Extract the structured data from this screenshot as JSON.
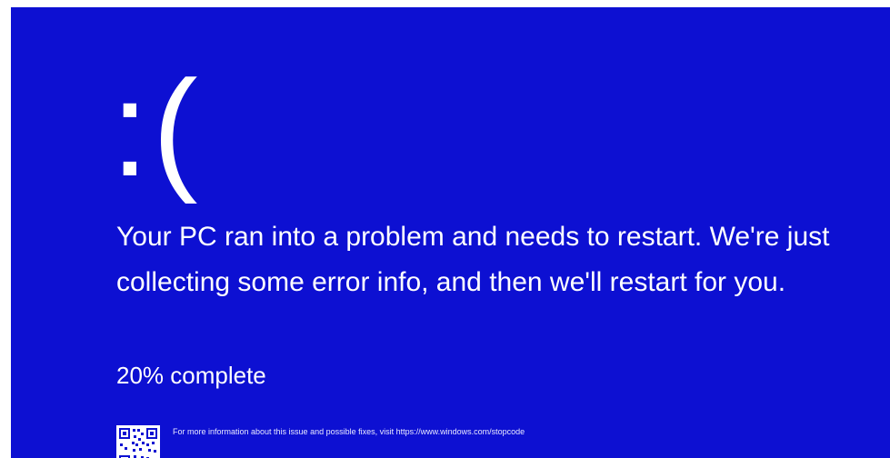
{
  "screen": {
    "background_color": "#0d10d2",
    "text_color": "#ffffff",
    "sad_face": ":(",
    "message": "Your PC ran into a problem and needs to restart. We're just collecting some error info, and then we'll restart for you.",
    "progress": {
      "text": "20% complete",
      "value": 20
    },
    "qr_code_icon": "qr-code-icon",
    "info_text": "For more information about this issue and possible fixes, visit https://www.windows.com/stopcode"
  }
}
